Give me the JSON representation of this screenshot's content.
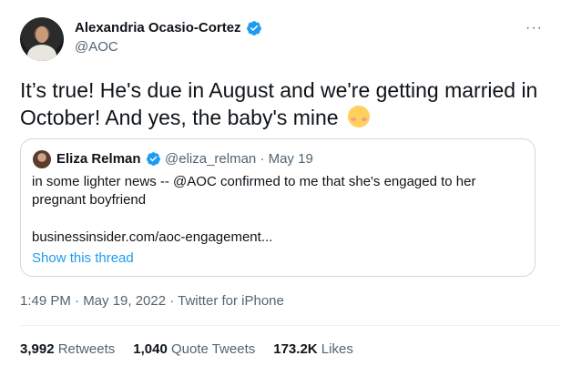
{
  "tweet": {
    "author_name": "Alexandria Ocasio-Cortez",
    "author_handle": "@AOC",
    "more_label": "···",
    "text": "It’s true! He's due in August and we're getting married in October! And yes, the baby's mine",
    "emoji": "smiling-face-with-blushing-cheeks",
    "timestamp": "1:49 PM · May 19, 2022 · Twitter for iPhone"
  },
  "quote": {
    "author_name": "Eliza Relman",
    "meta": "@eliza_relman · May 19",
    "text": "in some lighter news -- @AOC confirmed to me that she's engaged to her pregnant boyfriend",
    "link": "businessinsider.com/aoc-engagement...",
    "show_thread": "Show this thread"
  },
  "stats": [
    {
      "count": "3,992",
      "label": "Retweets"
    },
    {
      "count": "1,040",
      "label": "Quote Tweets"
    },
    {
      "count": "173.2K",
      "label": "Likes"
    }
  ],
  "colors": {
    "accent": "#1d9bf0",
    "text": "#0f1419",
    "muted": "#536471",
    "border": "#cfd9de"
  }
}
